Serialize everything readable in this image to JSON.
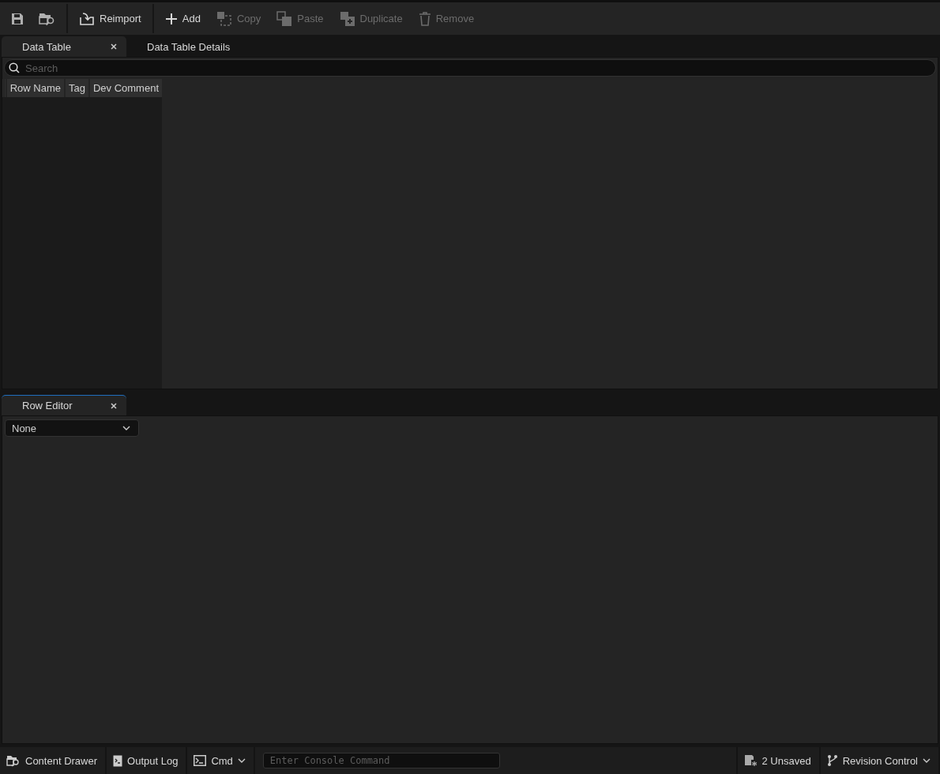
{
  "toolbar": {
    "items": [
      {
        "kind": "icon",
        "disabled": false
      },
      {
        "kind": "icon",
        "disabled": false
      },
      {
        "kind": "sep"
      },
      {
        "kind": "button",
        "label": "Reimport",
        "disabled": false
      },
      {
        "kind": "sep"
      },
      {
        "kind": "button",
        "label": "Add",
        "disabled": false
      },
      {
        "kind": "button",
        "label": "Copy",
        "disabled": true
      },
      {
        "kind": "button",
        "label": "Paste",
        "disabled": true
      },
      {
        "kind": "button",
        "label": "Duplicate",
        "disabled": true
      },
      {
        "kind": "button",
        "label": "Remove",
        "disabled": true
      }
    ]
  },
  "top_tabs": [
    {
      "label": "Data Table",
      "selected": true,
      "closable": true
    },
    {
      "label": "Data Table Details",
      "selected": false,
      "closable": false
    }
  ],
  "search": {
    "placeholder": "Search"
  },
  "table": {
    "columns": [
      "Row Name",
      "Tag",
      "Dev Comment"
    ]
  },
  "bottom_tabs": [
    {
      "label": "Row Editor",
      "selected": true,
      "closable": true
    }
  ],
  "row_struct_dropdown": {
    "value": "None"
  },
  "status_bar": {
    "content_drawer": "Content Drawer",
    "output_log": "Output Log",
    "cmd": "Cmd",
    "console_placeholder": "Enter Console Command",
    "unsaved": "2 Unsaved",
    "revision_control": "Revision Control"
  }
}
